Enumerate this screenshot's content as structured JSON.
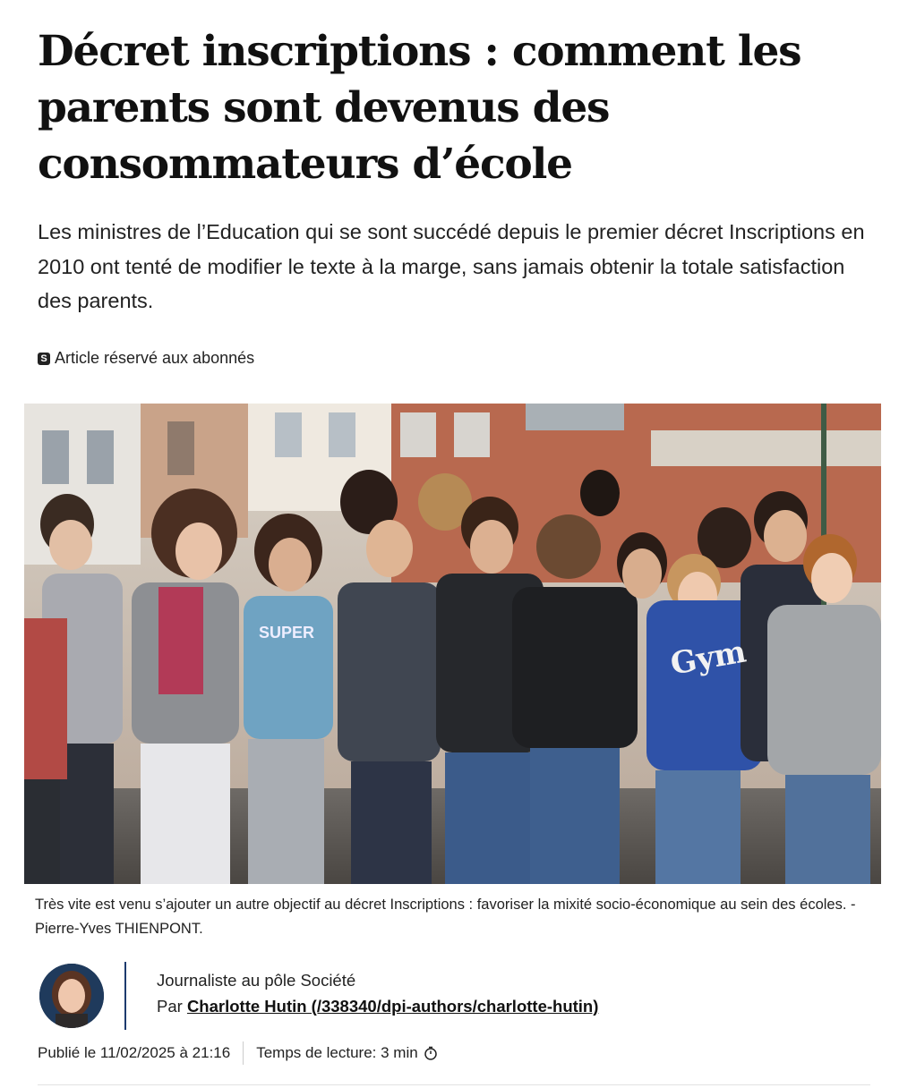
{
  "article": {
    "title": "Décret inscriptions : comment les parents sont devenus des consommateurs d’école",
    "lead": "Les ministres de l’Education qui se sont succédé depuis le premier décret Inscriptions en 2010 ont tenté de modifier le texte à la marge, sans jamais obtenir la totale satisfaction des parents.",
    "premium_badge": "S",
    "premium_label": "Article réservé aux abonnés"
  },
  "photo": {
    "caption": "Très vite est venu s’ajouter un autre objectif au décret Inscriptions : favoriser la mixité socio-économique au sein des écoles. - Pierre-Yves THIENPONT.",
    "shirt_text_1": "Gym",
    "shirt_text_2": "SUPER"
  },
  "author": {
    "role": "Journaliste au pôle Société",
    "by_prefix": "Par ",
    "name_link": "Charlotte Hutin (/338340/dpi-authors/charlotte-hutin)"
  },
  "meta": {
    "published": "Publié le 11/02/2025 à 21:16",
    "reading_time": "Temps de lecture: 3 min",
    "clock_icon": "stopwatch-icon"
  }
}
